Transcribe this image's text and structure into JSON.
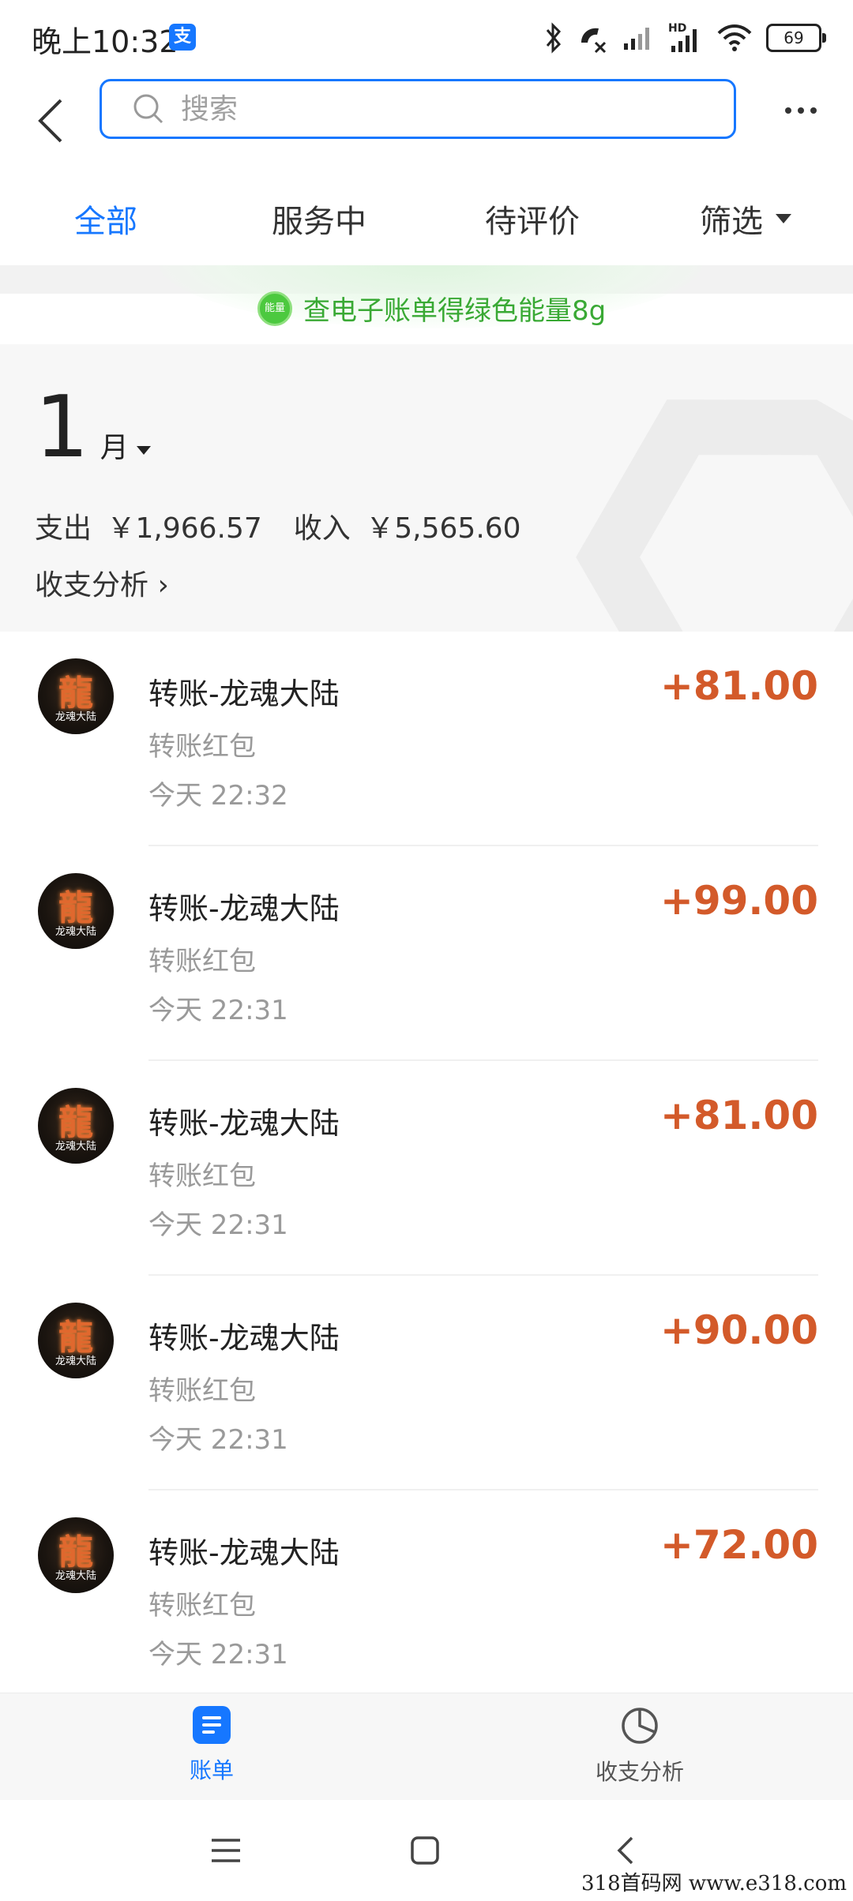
{
  "status_bar": {
    "time": "晚上10:32",
    "app_icon_label": "支",
    "battery": "69",
    "network_label": "HD",
    "icons": [
      "bluetooth-icon",
      "call-muted-icon",
      "signal-icon",
      "signal-hd-icon",
      "wifi-icon",
      "battery-icon"
    ]
  },
  "header": {
    "search_placeholder": "搜索"
  },
  "tabs": [
    {
      "label": "全部",
      "active": true
    },
    {
      "label": "服务中",
      "active": false
    },
    {
      "label": "待评价",
      "active": false
    },
    {
      "label": "筛选",
      "active": false
    }
  ],
  "energy_banner": {
    "badge": "能量",
    "text": "查电子账单得绿色能量8g"
  },
  "summary": {
    "month_number": "1",
    "month_unit": "月",
    "expense_label": "支出",
    "expense_value": "￥1,966.57",
    "income_label": "收入",
    "income_value": "￥5,565.60",
    "analysis_link": "收支分析 ›"
  },
  "transactions": [
    {
      "avatar_glyph": "龍",
      "avatar_caption": "龙魂大陆",
      "title": "转账-龙魂大陆",
      "subtitle": "转账红包",
      "time": "今天  22:32",
      "amount": "+81.00"
    },
    {
      "avatar_glyph": "龍",
      "avatar_caption": "龙魂大陆",
      "title": "转账-龙魂大陆",
      "subtitle": "转账红包",
      "time": "今天  22:31",
      "amount": "+99.00"
    },
    {
      "avatar_glyph": "龍",
      "avatar_caption": "龙魂大陆",
      "title": "转账-龙魂大陆",
      "subtitle": "转账红包",
      "time": "今天  22:31",
      "amount": "+81.00"
    },
    {
      "avatar_glyph": "龍",
      "avatar_caption": "龙魂大陆",
      "title": "转账-龙魂大陆",
      "subtitle": "转账红包",
      "time": "今天  22:31",
      "amount": "+90.00"
    },
    {
      "avatar_glyph": "龍",
      "avatar_caption": "龙魂大陆",
      "title": "转账-龙魂大陆",
      "subtitle": "转账红包",
      "time": "今天  22:31",
      "amount": "+72.00"
    }
  ],
  "bottom_tabs": [
    {
      "label": "账单",
      "icon": "bills-icon",
      "active": true
    },
    {
      "label": "收支分析",
      "icon": "pie-chart-icon",
      "active": false
    }
  ],
  "watermark": "318首码网   www.e318.com",
  "colors": {
    "accent": "#1677ff",
    "income": "#d35a2a",
    "energy_green": "#39a934"
  }
}
